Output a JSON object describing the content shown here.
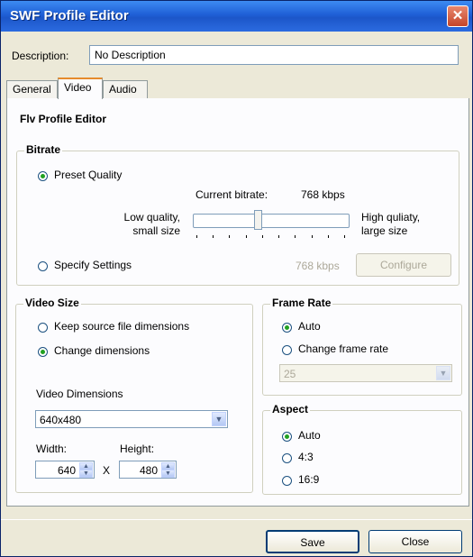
{
  "window": {
    "title": "SWF Profile Editor"
  },
  "description": {
    "label": "Description:",
    "value": "No Description"
  },
  "tabs": [
    {
      "label": "General",
      "active": false
    },
    {
      "label": "Video",
      "active": true
    },
    {
      "label": "Audio",
      "active": false
    }
  ],
  "panel": {
    "heading": "Flv Profile Editor"
  },
  "bitrate": {
    "group_title": "Bitrate",
    "preset_label": "Preset Quality",
    "preset_selected": true,
    "current_label": "Current bitrate:",
    "current_value": "768 kbps",
    "low_label_1": "Low quality,",
    "low_label_2": "small size",
    "high_label_1": "High quliaty,",
    "high_label_2": "large size",
    "slider_fraction": 0.42,
    "specify_label": "Specify Settings",
    "specify_selected": false,
    "specify_value": "768 kbps",
    "configure_label": "Configure"
  },
  "video_size": {
    "group_title": "Video Size",
    "keep_label": "Keep source file dimensions",
    "keep_selected": false,
    "change_label": "Change dimensions",
    "change_selected": true,
    "dims_label": "Video Dimensions",
    "dims_value": "640x480",
    "width_label": "Width:",
    "width_value": "640",
    "height_label": "Height:",
    "height_value": "480",
    "x_label": "X"
  },
  "frame_rate": {
    "group_title": "Frame Rate",
    "auto_label": "Auto",
    "auto_selected": true,
    "change_label": "Change frame rate",
    "change_selected": false,
    "rate_value": "25"
  },
  "aspect": {
    "group_title": "Aspect",
    "options": [
      {
        "label": "Auto",
        "selected": true
      },
      {
        "label": "4:3",
        "selected": false
      },
      {
        "label": "16:9",
        "selected": false
      }
    ]
  },
  "footer": {
    "save_label": "Save",
    "close_label": "Close"
  },
  "icons": {
    "close": "close-icon",
    "dropdown": "chevron-down-icon",
    "spin_up": "spin-up-icon",
    "spin_down": "spin-down-icon"
  },
  "colors": {
    "titlebar": "#1f5fd6",
    "radio_dot": "#21a121",
    "active_tab_accent": "#e68b2c"
  }
}
